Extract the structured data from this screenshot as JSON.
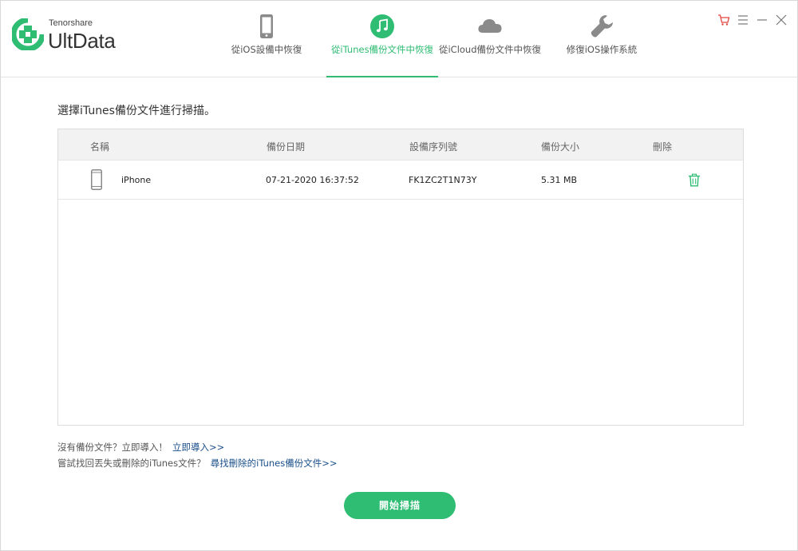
{
  "app": {
    "brand_small": "Tenorshare",
    "brand_big": "UltData"
  },
  "tabs": [
    {
      "label": "從iOS設備中恢復",
      "icon": "phone-icon",
      "active": false
    },
    {
      "label": "從iTunes備份文件中恢復",
      "icon": "music-note-icon",
      "active": true
    },
    {
      "label": "從iCloud備份文件中恢復",
      "icon": "cloud-icon",
      "active": false
    },
    {
      "label": "修復iOS操作系統",
      "icon": "wrench-icon",
      "active": false
    }
  ],
  "window_controls": [
    "cart-icon",
    "menu-icon",
    "minimize-icon",
    "close-icon"
  ],
  "colors": {
    "accent": "#2fbc73",
    "cart": "#e0443e",
    "link": "#1a4f8a"
  },
  "main": {
    "prompt": "選擇iTunes備份文件進行掃描。",
    "table": {
      "headers": [
        "名稱",
        "備份日期",
        "設備序列號",
        "備份大小",
        "刪除"
      ],
      "rows": [
        {
          "name": "iPhone",
          "date": "07-21-2020 16:37:52",
          "serial": "FK1ZC2T1N73Y",
          "size": "5.31 MB"
        }
      ]
    },
    "help1": {
      "text": "沒有備份文件？立即導入！",
      "link": "立即導入>>"
    },
    "help2": {
      "text": "嘗試找回丟失或刪除的iTunes文件？",
      "link": "尋找刪除的iTunes備份文件>>"
    },
    "start_button": "開始掃描"
  }
}
